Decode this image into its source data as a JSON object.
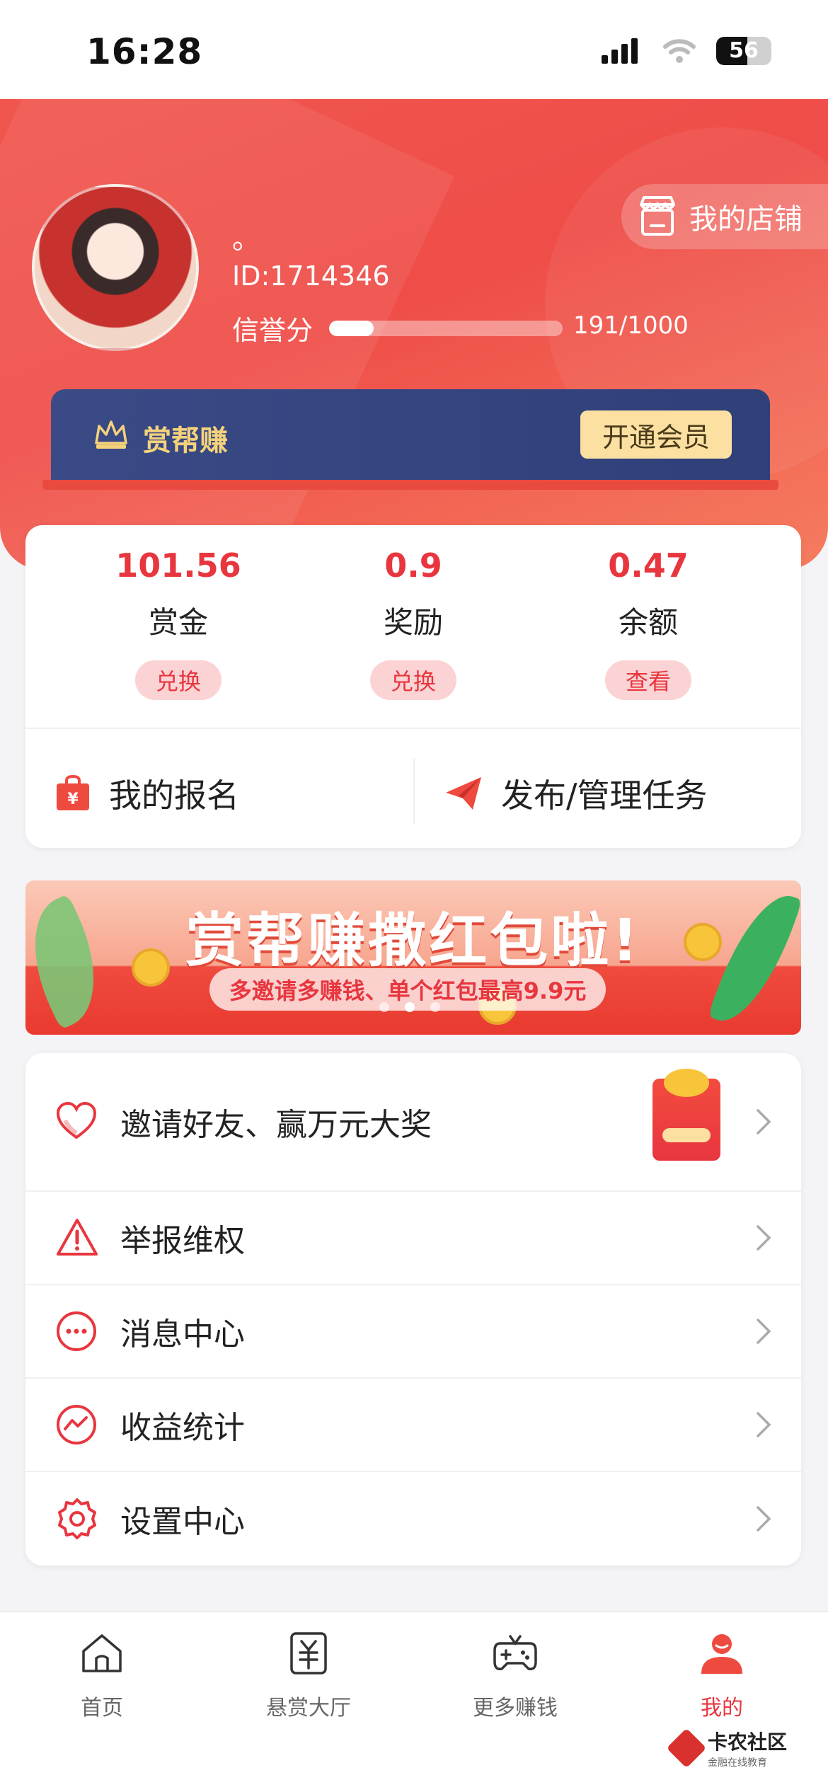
{
  "status_bar": {
    "time": "16:28",
    "battery": "56"
  },
  "profile": {
    "nickname": "。",
    "user_id": "ID:1714346",
    "credit_label": "信誉分",
    "credit_value": "191/1000",
    "credit_fraction": 0.191,
    "shop_label": "我的店铺"
  },
  "vip": {
    "title": "赏帮赚",
    "button": "开通会员"
  },
  "stats": [
    {
      "value": "101.56",
      "label": "赏金",
      "button": "兑换"
    },
    {
      "value": "0.9",
      "label": "奖励",
      "button": "兑换"
    },
    {
      "value": "0.47",
      "label": "余额",
      "button": "查看"
    }
  ],
  "actions": {
    "signup": "我的报名",
    "publish": "发布/管理任务"
  },
  "banner": {
    "title": "赏帮赚撒红包啦!",
    "subtitle": "多邀请多赚钱、单个红包最高9.9元"
  },
  "menu": [
    {
      "label": "邀请好友、赢万元大奖",
      "icon": "heart-icon"
    },
    {
      "label": "举报维权",
      "icon": "warning-icon"
    },
    {
      "label": "消息中心",
      "icon": "message-icon"
    },
    {
      "label": "收益统计",
      "icon": "chart-icon"
    },
    {
      "label": "设置中心",
      "icon": "settings-icon"
    }
  ],
  "tabs": [
    {
      "label": "首页",
      "icon": "home-icon"
    },
    {
      "label": "悬赏大厅",
      "icon": "bounty-icon"
    },
    {
      "label": "更多赚钱",
      "icon": "gamepad-icon"
    },
    {
      "label": "我的",
      "icon": "profile-icon",
      "active": true
    }
  ],
  "watermark": {
    "title": "卡农社区",
    "subtitle": "金融在线教育"
  },
  "colors": {
    "accent": "#e8363f",
    "header": "#ef4d48",
    "vip_band": "#34447e",
    "vip_gold": "#f5d27a"
  }
}
